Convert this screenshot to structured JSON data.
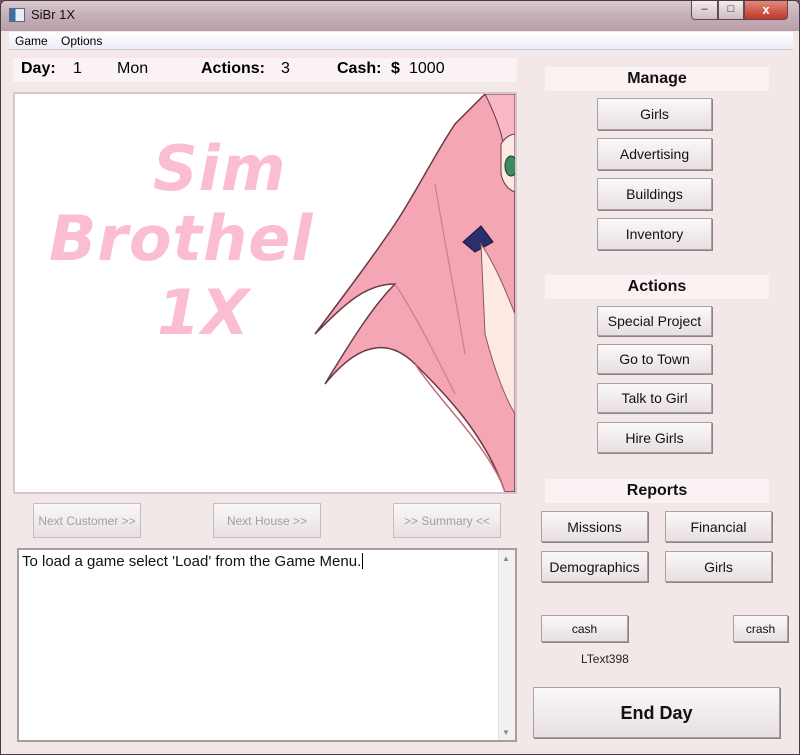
{
  "window": {
    "title": "SiBr 1X",
    "min_glyph": "–",
    "max_glyph": "□",
    "close_glyph": "x"
  },
  "menu": {
    "items": [
      "Game",
      "Options"
    ]
  },
  "status": {
    "day_label": "Day:",
    "day_value": "1",
    "weekday": "Mon",
    "actions_label": "Actions:",
    "actions_value": "3",
    "cash_label": "Cash:",
    "cash_currency": "$",
    "cash_value": "1000"
  },
  "logo": {
    "line1": "Sim",
    "line2": "Brothel",
    "line3": "1X",
    "color": "#fbbdd0"
  },
  "navigation": {
    "next_customer": "Next Customer  >>",
    "next_house": "Next House  >>",
    "summary": ">> Summary <<"
  },
  "message_box": {
    "text": "To load a game select 'Load' from the Game Menu."
  },
  "manage": {
    "heading": "Manage",
    "buttons": [
      "Girls",
      "Advertising",
      "Buildings",
      "Inventory"
    ]
  },
  "actions": {
    "heading": "Actions",
    "buttons": [
      "Special Project",
      "Go to Town",
      "Talk to Girl",
      "Hire Girls"
    ]
  },
  "reports": {
    "heading": "Reports",
    "buttons": [
      "Missions",
      "Financial",
      "Demographics",
      "Girls"
    ]
  },
  "debug": {
    "cash_button": "cash",
    "crash_button": "crash",
    "label": "LText398"
  },
  "end_day": {
    "label": "End Day"
  }
}
